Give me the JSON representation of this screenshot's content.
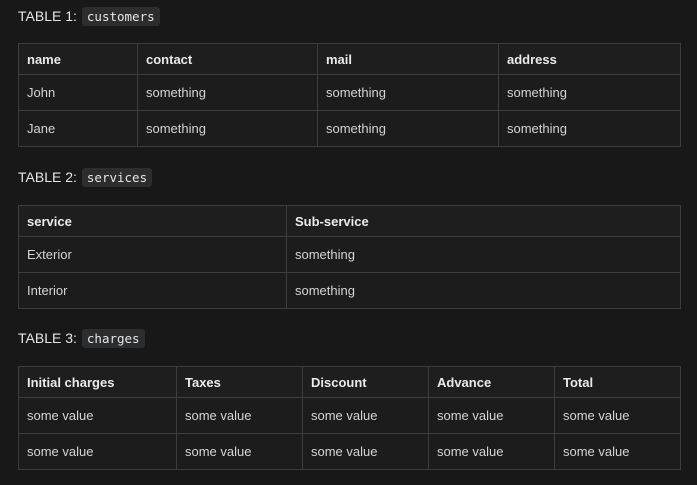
{
  "tables": [
    {
      "caption_prefix": "TABLE 1:",
      "caption_code": "customers",
      "headers": [
        "name",
        "contact",
        "mail",
        "address"
      ],
      "rows": [
        [
          "John",
          "something",
          "something",
          "something"
        ],
        [
          "Jane",
          "something",
          "something",
          "something"
        ]
      ]
    },
    {
      "caption_prefix": "TABLE 2:",
      "caption_code": "services",
      "headers": [
        "service",
        "Sub-service"
      ],
      "rows": [
        [
          "Exterior",
          "something"
        ],
        [
          "Interior",
          "something"
        ]
      ]
    },
    {
      "caption_prefix": "TABLE 3:",
      "caption_code": "charges",
      "headers": [
        "Initial charges",
        "Taxes",
        "Discount",
        "Advance",
        "Total"
      ],
      "rows": [
        [
          "some value",
          "some value",
          "some value",
          "some value",
          "some value"
        ],
        [
          "some value",
          "some value",
          "some value",
          "some value",
          "some value"
        ]
      ]
    }
  ],
  "colors": {
    "background": "#181818",
    "border": "#3d3d3d",
    "code_background": "#2b2d2f"
  }
}
